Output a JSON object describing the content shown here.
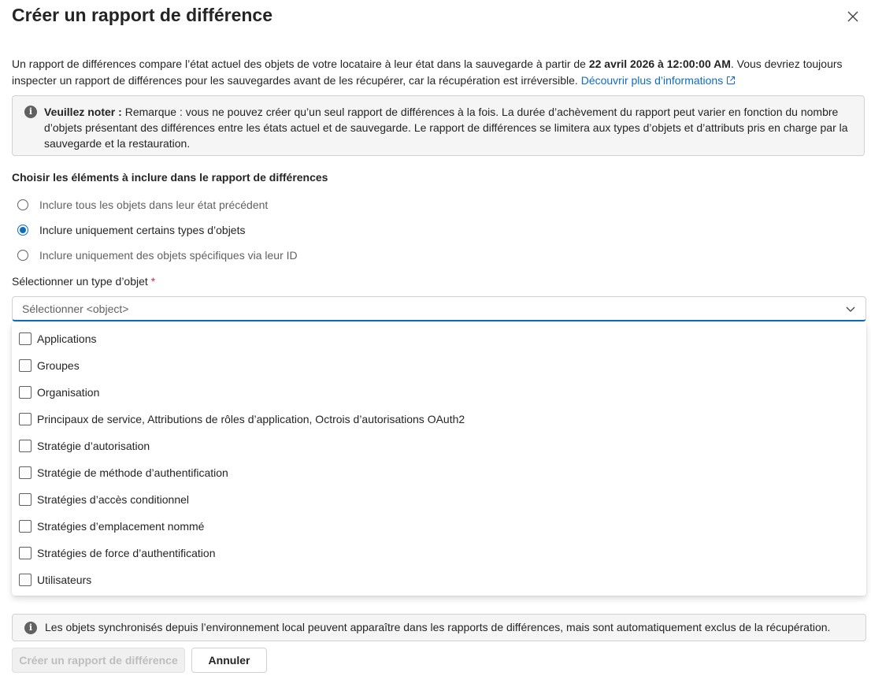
{
  "dialog": {
    "title": "Créer un rapport de différence",
    "close_icon": "close-icon"
  },
  "intro": {
    "text_before": "Un rapport de différences compare l’état actuel des objets de votre locataire à leur état dans la sauvegarde à partir de ",
    "date": "22 avril 2026 à 12:00:00 AM",
    "text_after": ". Vous devriez toujours inspecter un rapport de différences pour les sauvegardes avant de les récupérer, car la récupération est irréversible. ",
    "link": "Découvrir plus d’informations",
    "link_icon": "external-link-icon"
  },
  "notice": {
    "icon": "info-icon",
    "label": "Veuillez noter :",
    "text": " Remarque : vous ne pouvez créer qu’un seul rapport de différences à la fois. La durée d’achèvement du rapport peut varier en fonction du nombre d’objets présentant des différences entre les états actuel et de sauvegarde. Le rapport de différences se limitera aux types d’objets et d’attributs pris en charge par la sauvegarde et la restauration."
  },
  "choose": {
    "title": "Choisir les éléments à inclure dans le rapport de différences",
    "options": [
      {
        "label": "Inclure tous les objets dans leur état précédent",
        "checked": false
      },
      {
        "label": "Inclure uniquement certains types d’objets",
        "checked": true
      },
      {
        "label": "Inclure uniquement des objets spécifiques via leur ID",
        "checked": false
      }
    ]
  },
  "object_type": {
    "label": "Sélectionner un type d’objet",
    "required_mark": "*",
    "placeholder": "Sélectionner <object>",
    "chevron_icon": "chevron-down-icon",
    "items": [
      {
        "label": "Applications",
        "checked": false
      },
      {
        "label": "Groupes",
        "checked": false
      },
      {
        "label": "Organisation",
        "checked": false
      },
      {
        "label": "Principaux de service, Attributions de rôles d’application, Octrois d’autorisations OAuth2",
        "checked": false
      },
      {
        "label": "Stratégie d’autorisation",
        "checked": false
      },
      {
        "label": "Stratégie de méthode d’authentification",
        "checked": false
      },
      {
        "label": "Stratégies d’accès conditionnel",
        "checked": false
      },
      {
        "label": "Stratégies d’emplacement nommé",
        "checked": false
      },
      {
        "label": "Stratégies de force d’authentification",
        "checked": false
      },
      {
        "label": "Utilisateurs",
        "checked": false
      }
    ]
  },
  "sync_notice": {
    "icon": "info-icon",
    "text": "Les objets synchronisés depuis l’environnement local peuvent apparaître dans les rapports de différences, mais sont automatiquement exclus de la récupération."
  },
  "buttons": {
    "create": "Créer un rapport de différence",
    "cancel": "Annuler"
  },
  "colors": {
    "accent": "#0f6cbd",
    "required": "#c4314b",
    "notice_bg": "#f5f5f5"
  }
}
